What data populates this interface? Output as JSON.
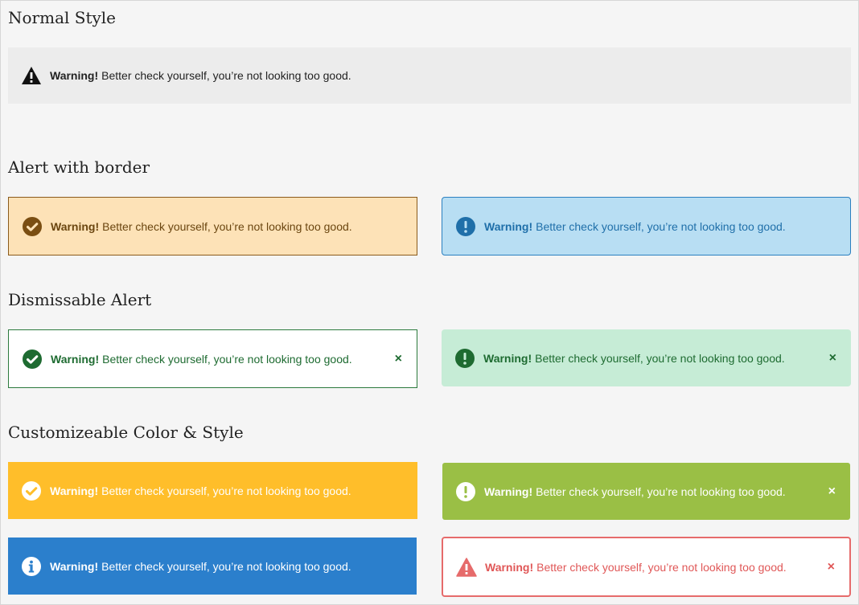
{
  "sections": {
    "normal": "Normal Style",
    "border": "Alert with border",
    "dismissable": "Dismissable Alert",
    "custom": "Customizeable  Color & Style"
  },
  "alert": {
    "title": "Warning!",
    "message": "Better check yourself, you’re not looking too good.",
    "close": "×"
  },
  "colors": {
    "page_bg": "#f5f5f5",
    "normal_bg": "#ececec",
    "border_orange_bg": "#fde2b7",
    "border_blue_bg": "#b8def3",
    "dismiss_green_bg": "#c6ecd6",
    "custom_yellow": "#ffbe2a",
    "custom_olive": "#9abf45",
    "custom_blue": "#2b7fcc",
    "custom_red": "#e66b6b"
  },
  "icons": {
    "normal": "warning-triangle-icon",
    "border_1": "check-circle-icon",
    "border_2": "exclamation-circle-icon",
    "dismiss_1": "check-circle-icon",
    "dismiss_2": "exclamation-circle-icon",
    "custom_1": "check-circle-icon",
    "custom_2": "exclamation-circle-icon",
    "custom_3": "info-circle-icon",
    "custom_4": "warning-triangle-icon"
  }
}
